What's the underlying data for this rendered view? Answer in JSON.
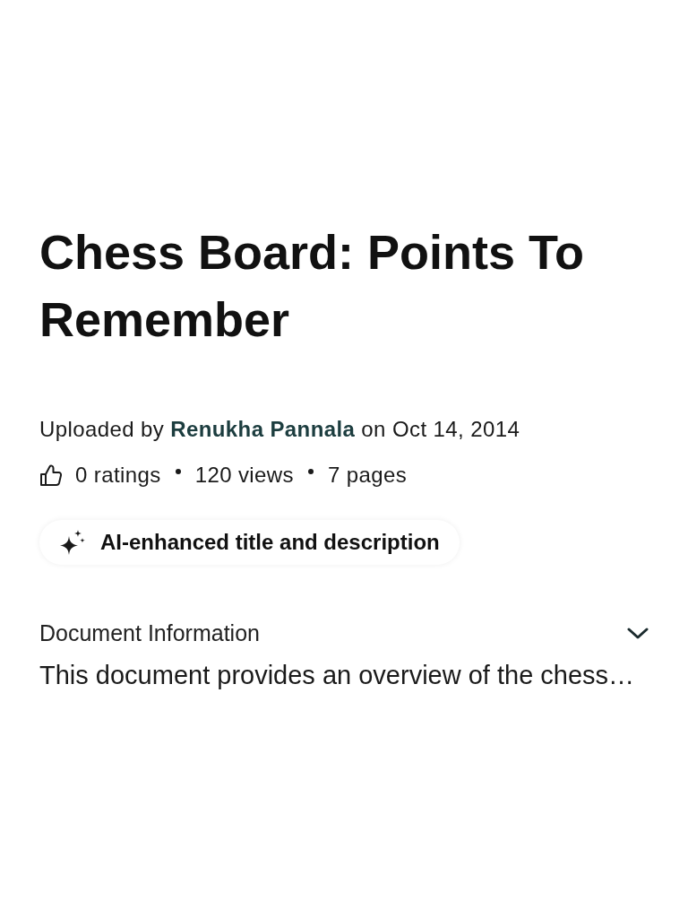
{
  "title": "Chess Board: Points To Remember",
  "upload": {
    "prefix": "Uploaded by",
    "author": "Renukha Pannala",
    "suffix": "on Oct 14, 2014"
  },
  "stats": [
    "0 ratings",
    "120 views",
    "7 pages"
  ],
  "ai_chip": {
    "label": "AI-enhanced title and description"
  },
  "document_information": {
    "heading": "Document Information",
    "expanded": false,
    "description": "This document provides an overview of the chess…"
  }
}
